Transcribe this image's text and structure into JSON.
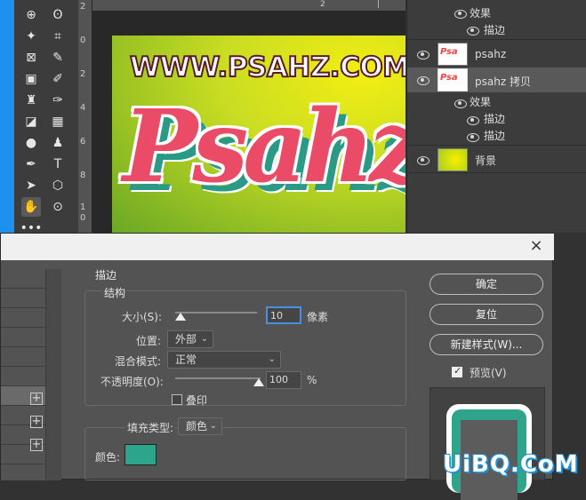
{
  "toolbar": {
    "tools": [
      {
        "icon": "move-icon",
        "glyph": "⊕"
      },
      {
        "icon": "lasso-icon",
        "glyph": "ʘ"
      },
      {
        "icon": "magic-wand-icon",
        "glyph": "✦"
      },
      {
        "icon": "crop-icon",
        "glyph": "⌗"
      },
      {
        "icon": "frame-icon",
        "glyph": "⊠"
      },
      {
        "icon": "eyedropper-icon",
        "glyph": "✎"
      },
      {
        "icon": "patch-icon",
        "glyph": "▣"
      },
      {
        "icon": "brush-icon",
        "glyph": "✐"
      },
      {
        "icon": "stamp-icon",
        "glyph": "♜"
      },
      {
        "icon": "history-brush-icon",
        "glyph": "✑"
      },
      {
        "icon": "eraser-icon",
        "glyph": "◪"
      },
      {
        "icon": "gradient-icon",
        "glyph": "▦"
      },
      {
        "icon": "blur-icon",
        "glyph": "●"
      },
      {
        "icon": "dodge-icon",
        "glyph": "♟"
      },
      {
        "icon": "pen-icon",
        "glyph": "✒"
      },
      {
        "icon": "type-icon",
        "glyph": "T"
      },
      {
        "icon": "path-select-icon",
        "glyph": "➤"
      },
      {
        "icon": "shape-icon",
        "glyph": "⬡"
      },
      {
        "icon": "hand-icon",
        "glyph": "✋"
      },
      {
        "icon": "zoom-icon",
        "glyph": "⊙"
      },
      {
        "icon": "more-icon",
        "glyph": "•••"
      }
    ]
  },
  "ruler": {
    "v_ticks": [
      "2",
      "0",
      "2",
      "4",
      "6",
      "8",
      "1",
      "0"
    ],
    "h_ticks": [
      "2",
      "|"
    ]
  },
  "canvas": {
    "url_text": "WWW.PSAHZ.COM",
    "art_text": "Psahz"
  },
  "layers": {
    "top_effects": {
      "label": "效果",
      "stroke": "描边"
    },
    "layer1": {
      "thumb": "Psa",
      "name": "psahz"
    },
    "layer2": {
      "thumb": "Psa",
      "name": "psahz 拷贝",
      "effects_label": "效果",
      "stroke1": "描边",
      "stroke2": "描边"
    },
    "bg": {
      "name": "背景"
    }
  },
  "dialog": {
    "close": "×",
    "section": "描边",
    "structure": "结构",
    "size_label": "大小(S):",
    "size_value": "10",
    "size_unit": "像素",
    "position_label": "位置:",
    "position_value": "外部",
    "blend_label": "混合模式:",
    "blend_value": "正常",
    "opacity_label": "不透明度(O):",
    "opacity_value": "100",
    "opacity_unit": "%",
    "overprint_label": "叠印",
    "fill_type_label": "填充类型:",
    "fill_type_value": "颜色",
    "color_label": "颜色:",
    "color_hex": "#2da58c",
    "ok": "确定",
    "reset": "复位",
    "new_style": "新建样式(W)...",
    "preview_label": "预览(V)",
    "preview_checked": true,
    "plus": "+"
  },
  "watermark": "UiBQ.CoM"
}
